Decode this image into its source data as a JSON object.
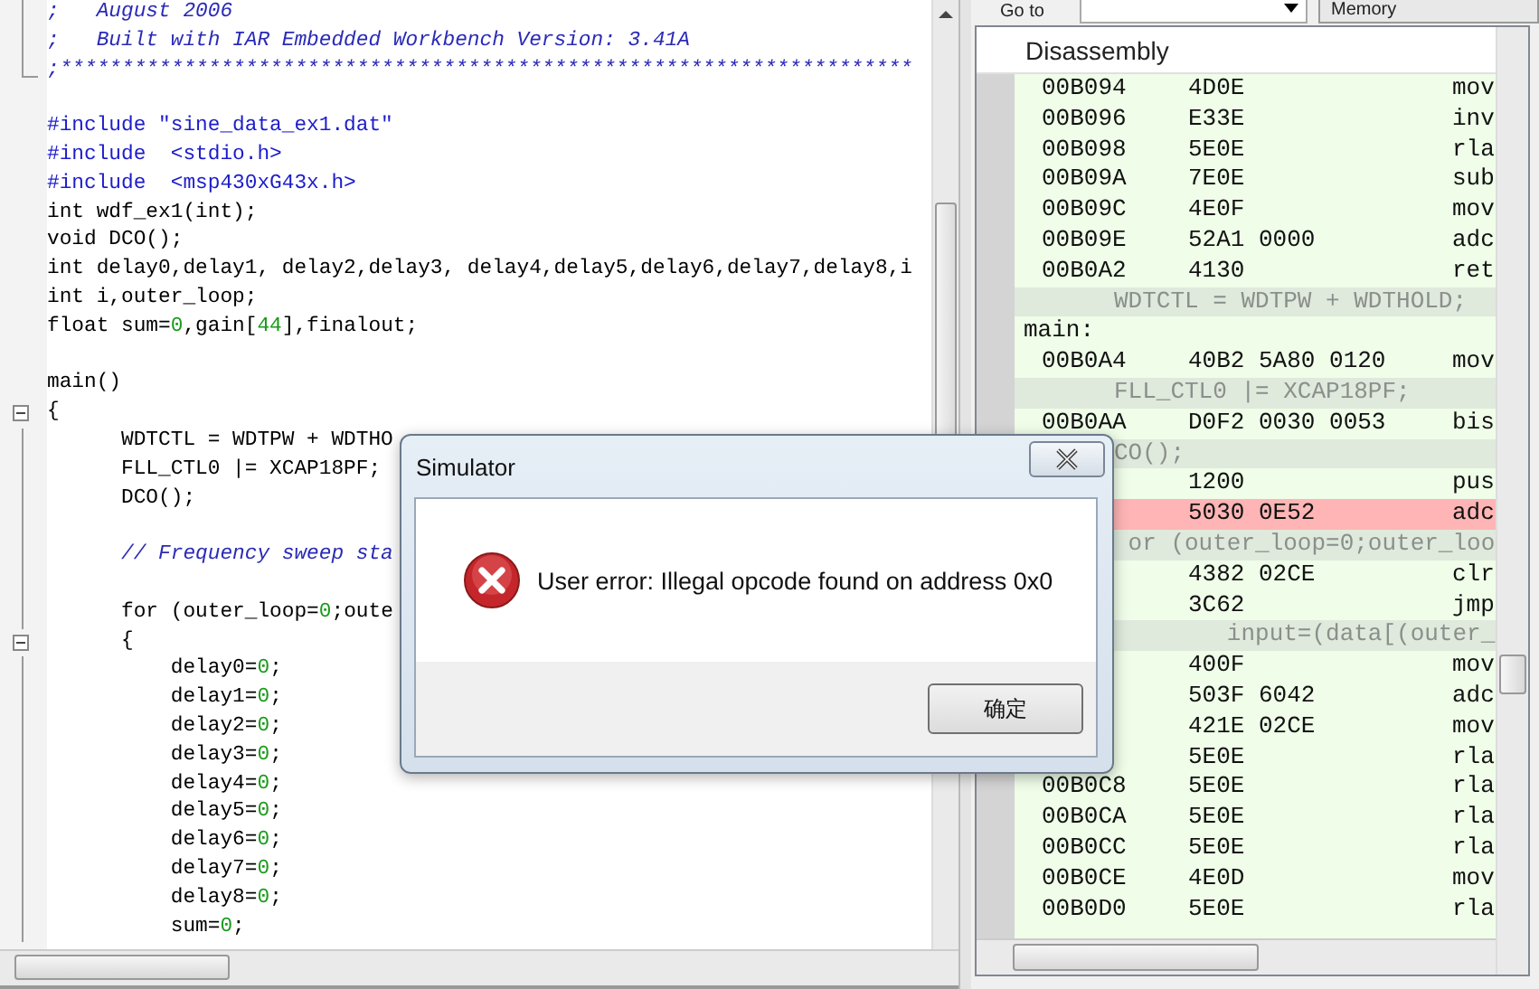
{
  "editor": {
    "lines": [
      {
        "kind": "text",
        "segments": [
          {
            "kind": "comment",
            "text": ";   August 2006"
          }
        ]
      },
      {
        "kind": "text",
        "segments": [
          {
            "kind": "comment",
            "text": ";   Built with IAR Embedded Workbench Version: 3.41A"
          }
        ]
      },
      {
        "kind": "text",
        "segments": [
          {
            "kind": "comment",
            "text": ";*********************************************************************"
          }
        ]
      },
      {
        "kind": "blank"
      },
      {
        "kind": "text",
        "segments": [
          {
            "kind": "preprocessor",
            "text": "#include \"sine_data_ex1.dat\""
          }
        ]
      },
      {
        "kind": "text",
        "segments": [
          {
            "kind": "preprocessor",
            "text": "#include  <stdio.h>"
          }
        ]
      },
      {
        "kind": "text",
        "segments": [
          {
            "kind": "preprocessor",
            "text": "#include  <msp430xG43x.h>"
          }
        ]
      },
      {
        "kind": "text",
        "segments": [
          {
            "kind": "plain",
            "text": "int wdf_ex1(int);"
          }
        ]
      },
      {
        "kind": "text",
        "segments": [
          {
            "kind": "plain",
            "text": "void DCO();"
          }
        ]
      },
      {
        "kind": "text",
        "segments": [
          {
            "kind": "plain",
            "text": "int delay0,delay1, delay2,delay3, delay4,delay5,delay6,delay7,delay8,i"
          }
        ]
      },
      {
        "kind": "text",
        "segments": [
          {
            "kind": "plain",
            "text": "int i,outer_loop;"
          }
        ]
      },
      {
        "kind": "text",
        "segments": [
          {
            "kind": "plain",
            "text": "float sum="
          },
          {
            "kind": "number",
            "text": "0"
          },
          {
            "kind": "plain",
            "text": ",gain["
          },
          {
            "kind": "number",
            "text": "44"
          },
          {
            "kind": "plain",
            "text": "],finalout;"
          }
        ]
      },
      {
        "kind": "blank"
      },
      {
        "kind": "text",
        "segments": [
          {
            "kind": "plain",
            "text": "main()"
          }
        ]
      },
      {
        "kind": "text",
        "expanded": true,
        "segments": [
          {
            "kind": "plain",
            "text": "{"
          }
        ]
      },
      {
        "kind": "text",
        "segments": [
          {
            "kind": "plain",
            "text": "      WDTCTL = WDTPW + WDTHO"
          }
        ]
      },
      {
        "kind": "text",
        "segments": [
          {
            "kind": "plain",
            "text": "      FLL_CTL0 |= XCAP18PF;"
          }
        ]
      },
      {
        "kind": "text",
        "segments": [
          {
            "kind": "plain",
            "text": "      DCO();"
          }
        ]
      },
      {
        "kind": "blank"
      },
      {
        "kind": "text",
        "segments": [
          {
            "kind": "comment",
            "text": "      // Frequency sweep sta"
          }
        ]
      },
      {
        "kind": "blank"
      },
      {
        "kind": "text",
        "segments": [
          {
            "kind": "plain",
            "text": "      for (outer_loop="
          },
          {
            "kind": "number",
            "text": "0"
          },
          {
            "kind": "plain",
            "text": ";oute"
          }
        ]
      },
      {
        "kind": "text",
        "expanded": true,
        "segments": [
          {
            "kind": "plain",
            "text": "      {"
          }
        ]
      },
      {
        "kind": "text",
        "segments": [
          {
            "kind": "plain",
            "text": "          delay0="
          },
          {
            "kind": "number",
            "text": "0"
          },
          {
            "kind": "plain",
            "text": ";"
          }
        ]
      },
      {
        "kind": "text",
        "segments": [
          {
            "kind": "plain",
            "text": "          delay1="
          },
          {
            "kind": "number",
            "text": "0"
          },
          {
            "kind": "plain",
            "text": ";"
          }
        ]
      },
      {
        "kind": "text",
        "segments": [
          {
            "kind": "plain",
            "text": "          delay2="
          },
          {
            "kind": "number",
            "text": "0"
          },
          {
            "kind": "plain",
            "text": ";"
          }
        ]
      },
      {
        "kind": "text",
        "segments": [
          {
            "kind": "plain",
            "text": "          delay3="
          },
          {
            "kind": "number",
            "text": "0"
          },
          {
            "kind": "plain",
            "text": ";"
          }
        ]
      },
      {
        "kind": "text",
        "segments": [
          {
            "kind": "plain",
            "text": "          delay4="
          },
          {
            "kind": "number",
            "text": "0"
          },
          {
            "kind": "plain",
            "text": ";"
          }
        ]
      },
      {
        "kind": "text",
        "segments": [
          {
            "kind": "plain",
            "text": "          delay5="
          },
          {
            "kind": "number",
            "text": "0"
          },
          {
            "kind": "plain",
            "text": ";"
          }
        ]
      },
      {
        "kind": "text",
        "segments": [
          {
            "kind": "plain",
            "text": "          delay6="
          },
          {
            "kind": "number",
            "text": "0"
          },
          {
            "kind": "plain",
            "text": ";"
          }
        ]
      },
      {
        "kind": "text",
        "segments": [
          {
            "kind": "plain",
            "text": "          delay7="
          },
          {
            "kind": "number",
            "text": "0"
          },
          {
            "kind": "plain",
            "text": ";"
          }
        ]
      },
      {
        "kind": "text",
        "segments": [
          {
            "kind": "plain",
            "text": "          delay8="
          },
          {
            "kind": "number",
            "text": "0"
          },
          {
            "kind": "plain",
            "text": ";"
          }
        ]
      },
      {
        "kind": "text",
        "segments": [
          {
            "kind": "plain",
            "text": "          sum="
          },
          {
            "kind": "number",
            "text": "0"
          },
          {
            "kind": "plain",
            "text": ";"
          }
        ]
      }
    ]
  },
  "toolbar": {
    "goto_label": "Go to",
    "memory_label": "Memory"
  },
  "disassembly": {
    "title": "Disassembly",
    "rows": [
      {
        "kind": "instr",
        "address": "00B094",
        "code": "4D0E",
        "mnemonic": "mov",
        "current": false
      },
      {
        "kind": "instr",
        "address": "00B096",
        "code": "E33E",
        "mnemonic": "inv",
        "current": false
      },
      {
        "kind": "instr",
        "address": "00B098",
        "code": "5E0E",
        "mnemonic": "rla",
        "current": false
      },
      {
        "kind": "instr",
        "address": "00B09A",
        "code": "7E0E",
        "mnemonic": "sub",
        "current": false
      },
      {
        "kind": "instr",
        "address": "00B09C",
        "code": "4E0F",
        "mnemonic": "mov",
        "current": false
      },
      {
        "kind": "instr",
        "address": "00B09E",
        "code": "52A1 0000",
        "mnemonic": "adc",
        "current": false
      },
      {
        "kind": "instr",
        "address": "00B0A2",
        "code": "4130",
        "mnemonic": "ret",
        "current": false
      },
      {
        "kind": "source",
        "text": "WDTCTL = WDTPW + WDTHOLD;"
      },
      {
        "kind": "label",
        "text": "main:"
      },
      {
        "kind": "instr",
        "address": "00B0A4",
        "code": "40B2 5A80 0120",
        "mnemonic": "mov",
        "current": false
      },
      {
        "kind": "source",
        "text": "FLL_CTL0 |= XCAP18PF;"
      },
      {
        "kind": "instr",
        "address": "00B0AA",
        "code": "D0F2 0030 0053",
        "mnemonic": "bis",
        "current": false
      },
      {
        "kind": "source",
        "text": "CO();"
      },
      {
        "kind": "instr",
        "code": "1200",
        "mnemonic": "pus",
        "current": false
      },
      {
        "kind": "instr",
        "code": "5030 0E52",
        "mnemonic": "adc",
        "current": true
      },
      {
        "kind": "source",
        "text": " or (outer_loop=0;outer_loo"
      },
      {
        "kind": "instr",
        "code": "4382 02CE",
        "mnemonic": "clr",
        "current": false
      },
      {
        "kind": "instr",
        "code": "3C62",
        "mnemonic": "jmp",
        "current": false
      },
      {
        "kind": "source",
        "text": "        input=(data[(outer_"
      },
      {
        "kind": "instr",
        "code": "400F",
        "mnemonic": "mov",
        "current": false
      },
      {
        "kind": "instr",
        "code": "503F 6042",
        "mnemonic": "adc",
        "current": false
      },
      {
        "kind": "instr",
        "code": "421E 02CE",
        "mnemonic": "mov",
        "current": false
      },
      {
        "kind": "instr",
        "code": "5E0E",
        "mnemonic": "rla",
        "current": false
      },
      {
        "kind": "instr",
        "address": "00B0C8",
        "code": "5E0E",
        "mnemonic": "rla",
        "current": false
      },
      {
        "kind": "instr",
        "address": "00B0CA",
        "code": "5E0E",
        "mnemonic": "rla",
        "current": false
      },
      {
        "kind": "instr",
        "address": "00B0CC",
        "code": "5E0E",
        "mnemonic": "rla",
        "current": false
      },
      {
        "kind": "instr",
        "address": "00B0CE",
        "code": "4E0D",
        "mnemonic": "mov",
        "current": false
      },
      {
        "kind": "instr",
        "address": "00B0D0",
        "code": "5E0E",
        "mnemonic": "rla",
        "current": false
      }
    ]
  },
  "dialog": {
    "title": "Simulator",
    "message": "User error: Illegal opcode found on address 0x0",
    "buttons": [
      "确定"
    ]
  }
}
